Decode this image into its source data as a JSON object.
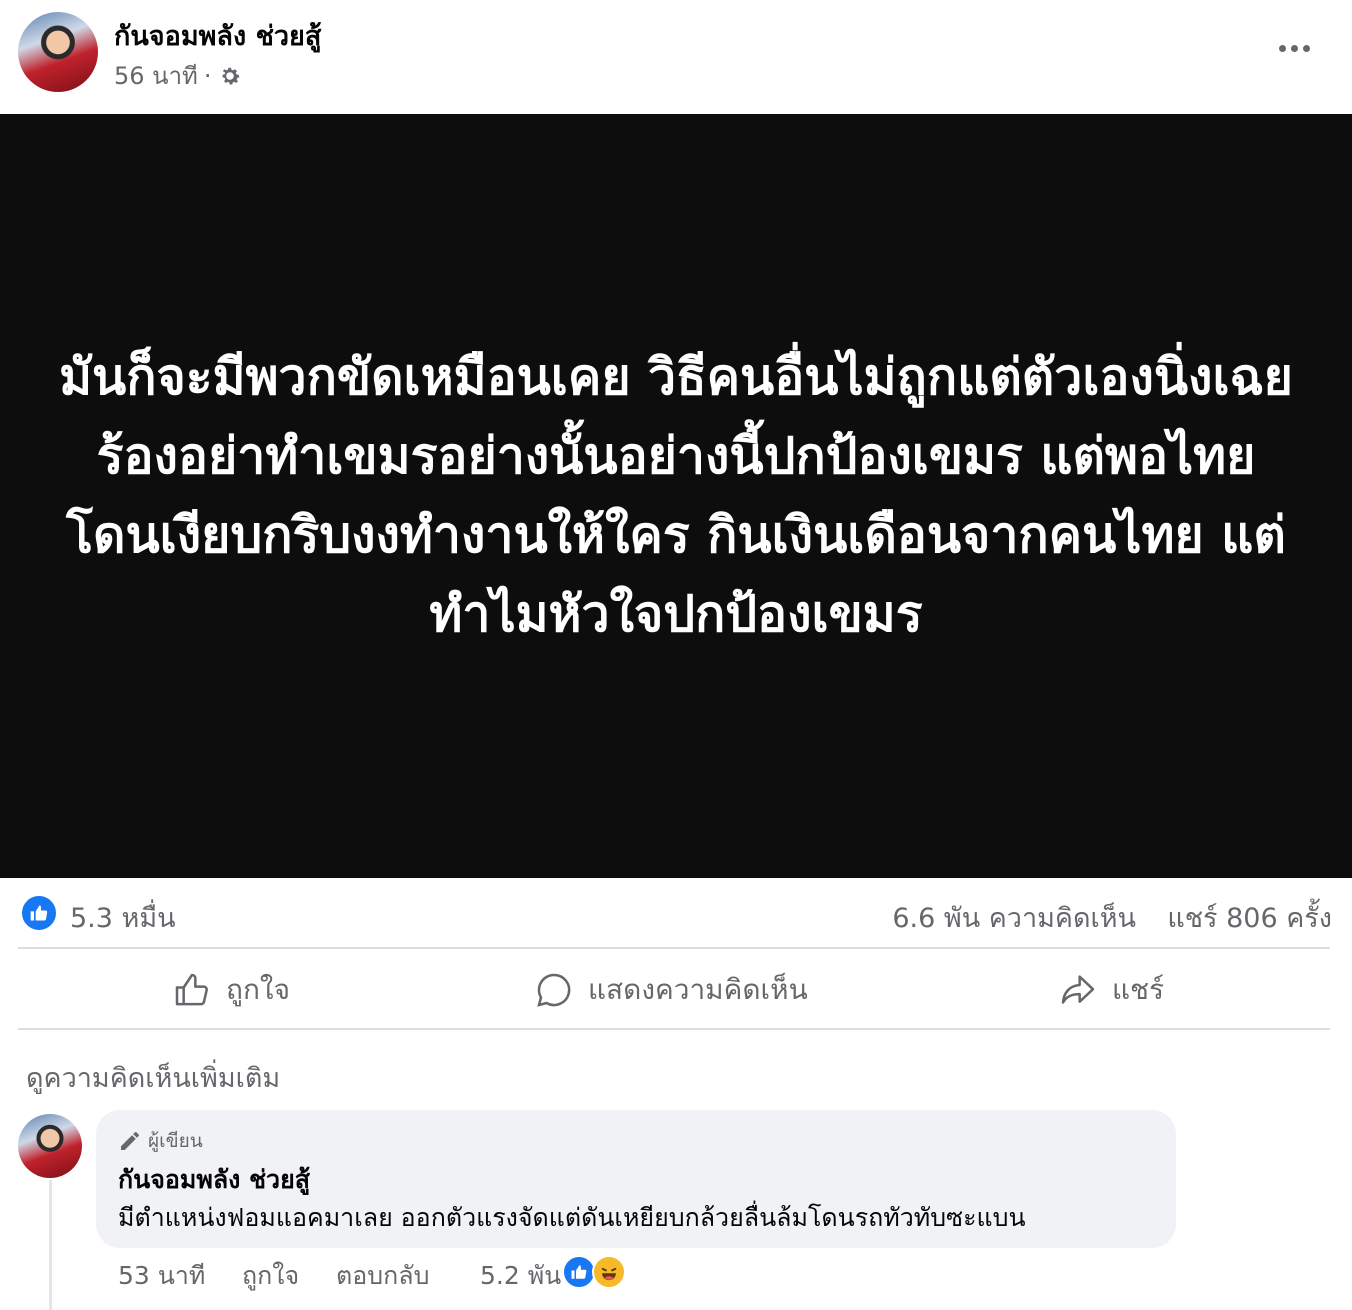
{
  "post": {
    "author_name": "กันจอมพลัง ช่วยสู้",
    "time": "56 นาที",
    "separator": "·",
    "privacy_icon": "gear-icon",
    "more_icon": "more-options-icon",
    "image_text": "มันก็จะมีพวกขัดเหมือนเคย วิธีคนอื่นไม่ถูกแต่ตัวเองนิ่งเฉย ร้องอย่าทำเขมรอย่างนั้นอย่างนี้ปกป้องเขมร แต่พอไทยโดนเงียบกริบงงทำงานให้ใคร กินเงินเดือนจากคนไทย แต่ทำไมหัวใจปกป้องเขมร"
  },
  "stats": {
    "likes": "5.3 หมื่น",
    "comments": "6.6 พัน ความคิดเห็น",
    "shares": "แชร์ 806 ครั้ง"
  },
  "actions": {
    "like": "ถูกใจ",
    "comment": "แสดงความคิดเห็น",
    "share": "แชร์"
  },
  "comments_section": {
    "view_more": "ดูความคิดเห็นเพิ่มเติม"
  },
  "comment": {
    "badge": "ผู้เขียน",
    "author": "กันจอมพลัง ช่วยสู้",
    "text": "มีตำแหน่งฟอมแอคมาเลย ออกตัวแรงจัดแต่ดันเหยียบกล้วยลื่นล้มโดนรถทัวทับซะแบน",
    "time": "53 นาที",
    "like": "ถูกใจ",
    "reply": "ตอบกลับ",
    "reaction_count": "5.2 พัน"
  },
  "colors": {
    "accent": "#1877f2",
    "secondary_text": "#65676b",
    "image_background": "#0d0d0d",
    "bubble": "#f0f2f5"
  }
}
